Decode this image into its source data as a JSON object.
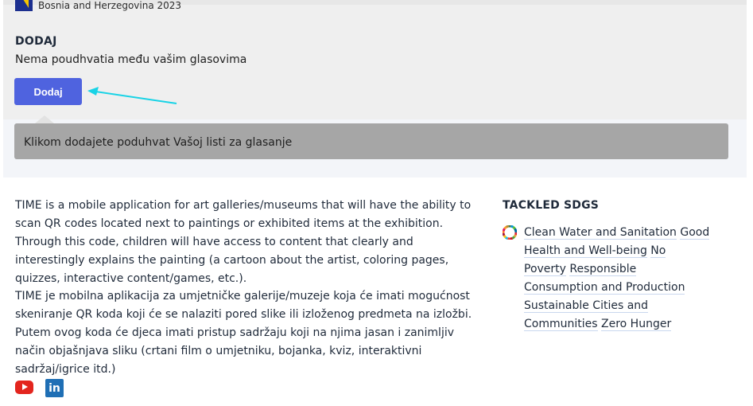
{
  "header": {
    "country": "Bosnia and Herzegovina 2023"
  },
  "vote": {
    "title": "DODAJ",
    "subtitle": "Nema poudhvatia među vašim glasovima",
    "button_label": "Dodaj",
    "tooltip": "Klikom dodajete poduhvat Vašoj listi za glasanje"
  },
  "description": {
    "en": "TIME is a mobile application for art galleries/museums that will have the ability to scan QR codes located next to paintings or exhibited items at the exhibition. Through this code, children will have access to content that clearly and interestingly explains the painting (a cartoon about the artist, coloring pages, quizzes, interactive content/games, etc.).",
    "bs": "TIME je mobilna aplikacija za umjetničke galerije/muzeje koja će imati mogućnost skeniranje QR koda koji će se nalaziti pored slike ili izloženog predmeta na izložbi. Putem ovog koda će djeca imati pristup sadržaju koji na njima jasan i zanimljiv način objašnjava sliku (crtani film o umjetniku, bojanka, kviz, interaktivni sadržaj/igrice itd.)"
  },
  "sdgs": {
    "title": "TACKLED SDGS",
    "items": [
      "Clean Water and Sanitation",
      "Good Health and Well-being",
      "No Poverty",
      "Responsible Consumption and Production",
      "Sustainable Cities and Communities",
      "Zero Hunger"
    ]
  },
  "social": {
    "youtube_icon": "youtube-icon",
    "linkedin_icon": "linkedin-icon",
    "linkedin_glyph": "in"
  },
  "colors": {
    "button": "#4f63df",
    "tooltip": "#a6a6a6",
    "arrow": "#19d3e6",
    "youtube": "#e3251e",
    "linkedin": "#1f6fb5"
  }
}
